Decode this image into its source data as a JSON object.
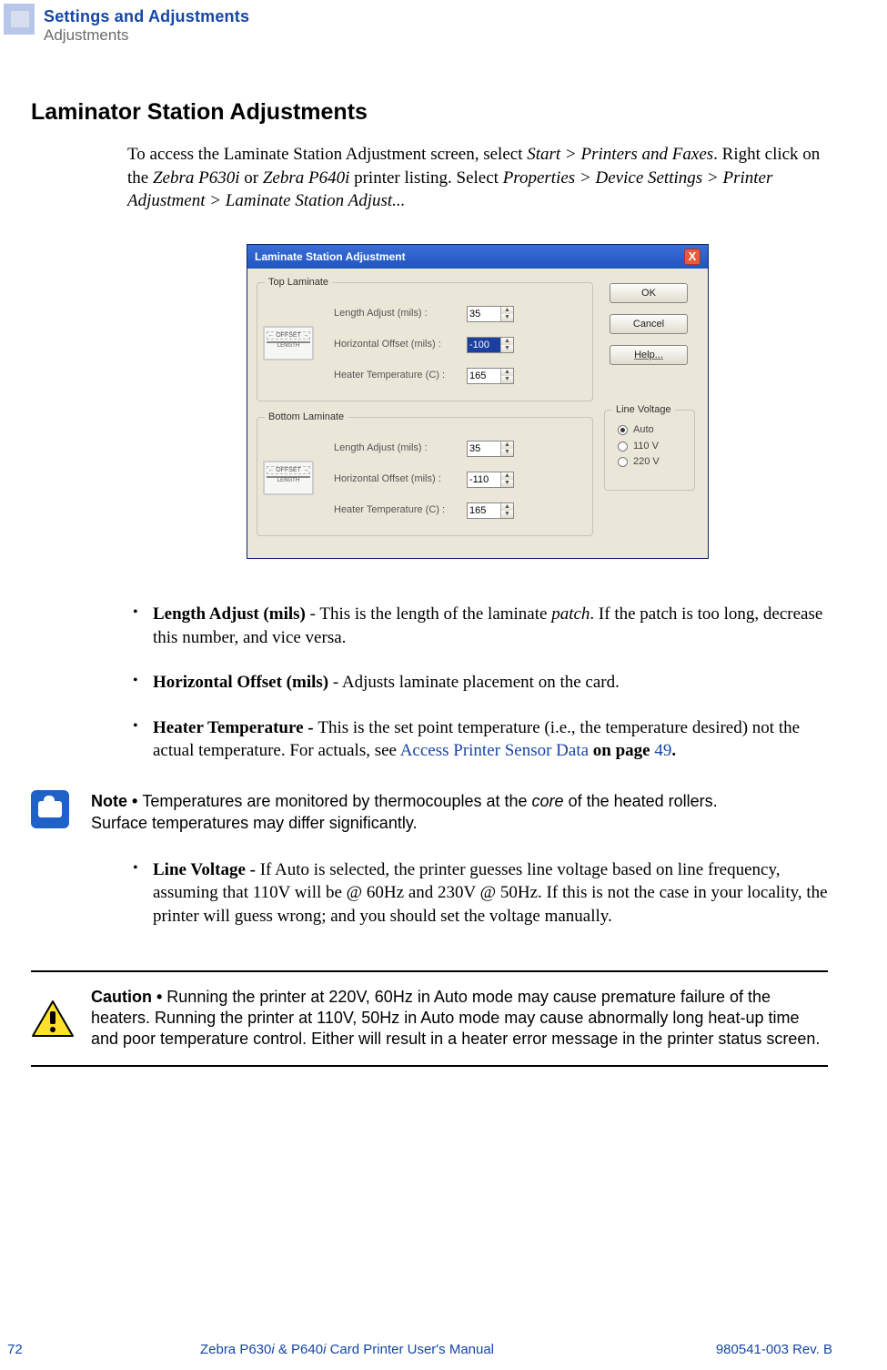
{
  "header": {
    "chapter_title": "Settings and Adjustments",
    "chapter_sub": "Adjustments"
  },
  "section_title": "Laminator Station Adjustments",
  "intro": {
    "p1a": "To access the Laminate Station Adjustment screen, select ",
    "p1b": "Start > Printers and Faxes",
    "p1c": ". Right click on the ",
    "p1d": "Zebra P630i",
    "p1e": " or ",
    "p1f": "Zebra P640i",
    "p1g": " printer listing. Select ",
    "p1h": "Properties > Device Settings > Printer Adjustment > Laminate Station Adjust..."
  },
  "dialog": {
    "title": "Laminate Station Adjustment",
    "close": "X",
    "top_legend": "Top Laminate",
    "bottom_legend": "Bottom Laminate",
    "lbl_length": "Length Adjust (mils) :",
    "lbl_hoff": "Horizontal Offset (mils) :",
    "lbl_heat": "Heater Temperature (C) :",
    "top_len": "35",
    "top_hoff": "-100",
    "top_heat": "165",
    "bot_len": "35",
    "bot_hoff": "-110",
    "bot_heat": "165",
    "btn_ok": "OK",
    "btn_cancel": "Cancel",
    "btn_help": "Help...",
    "lv_legend": "Line Voltage",
    "lv_auto": "Auto",
    "lv_110": "110 V",
    "lv_220": "220 V"
  },
  "bullets": {
    "b1a": "Length Adjust (mils)",
    "b1b": " - This is the length of the laminate ",
    "b1c": "patch",
    "b1d": ". If the patch is too long, decrease this number, and vice versa.",
    "b2a": "Horizontal Offset (mils)",
    "b2b": " - Adjusts laminate placement on the card.",
    "b3a": "Heater Temperature - ",
    "b3b": "This is the set point temperature (i.e., the temperature desired) not the actual temperature. For actuals, see ",
    "b3link": "Access Printer Sensor Data",
    "b3c": " on page ",
    "b3page": "49",
    "b3d": "."
  },
  "note": {
    "label": "Note • ",
    "t1": "Temperatures are monitored by thermocouples at the ",
    "t2": "core",
    "t3": " of the heated rollers. Surface temperatures may differ significantly."
  },
  "bullet4": {
    "a": "Line Voltage - ",
    "b": "If Auto is selected, the printer guesses line voltage based on line frequency, assuming that 110V will be @ 60Hz and 230V @ 50Hz. If this is not the case in your locality, the printer will guess wrong; and you should set the voltage manually."
  },
  "caution": {
    "label": "Caution • ",
    "text": " Running the printer at 220V, 60Hz in Auto mode may cause premature failure of the heaters. Running the printer at 110V, 50Hz in Auto mode may cause abnormally long heat-up time and poor temperature control. Either will result in a heater error message in the printer status screen."
  },
  "footer": {
    "page": "72",
    "center_a": "Zebra P630",
    "center_i1": "i",
    "center_b": " & P640",
    "center_i2": "i",
    "center_c": " Card Printer User's Manual",
    "right": "980541-003 Rev. B"
  }
}
